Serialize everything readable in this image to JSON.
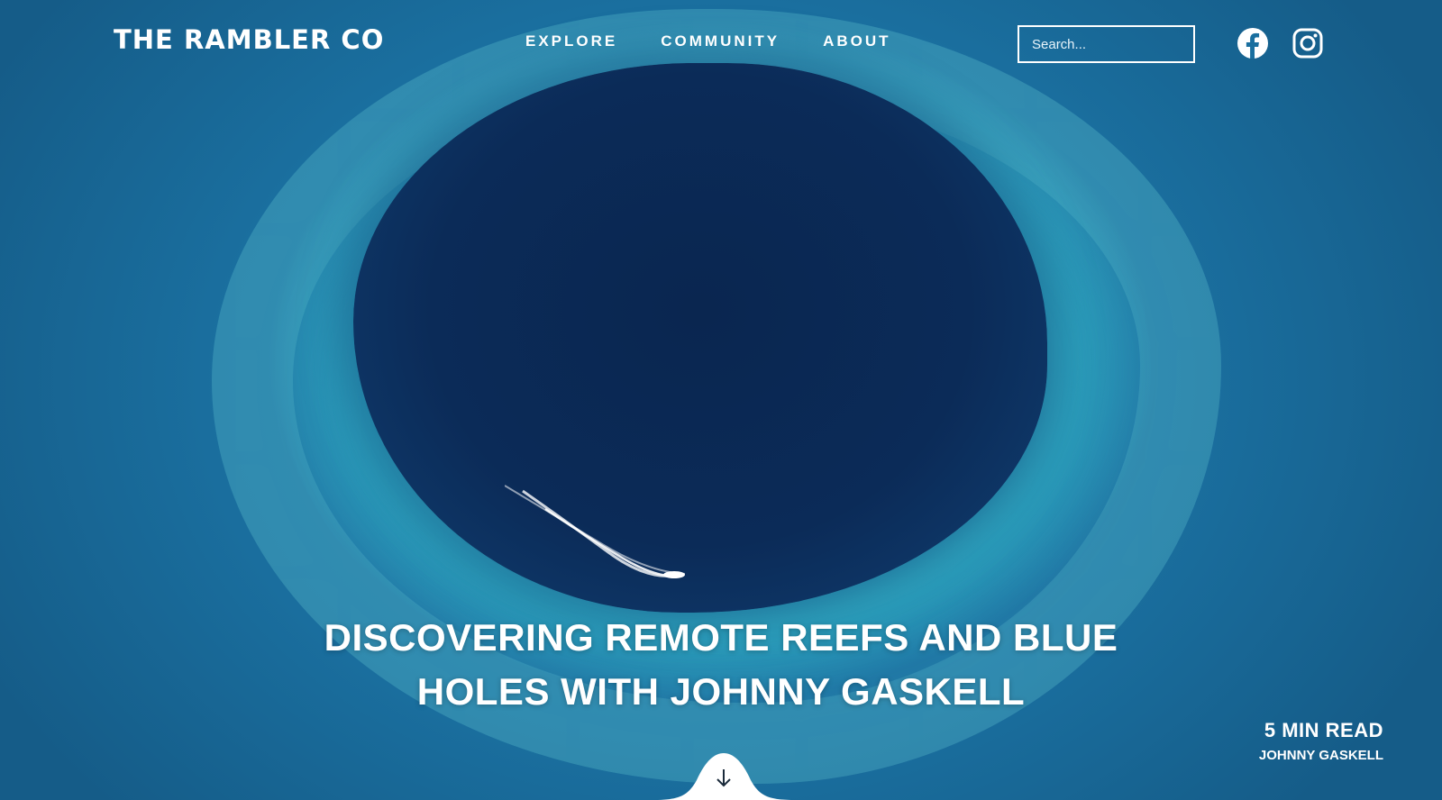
{
  "brand": {
    "logo": "THE RAMBLER CO"
  },
  "nav": {
    "items": [
      "EXPLORE",
      "COMMUNITY",
      "ABOUT"
    ]
  },
  "search": {
    "placeholder": "Search..."
  },
  "social": {
    "icons": [
      "facebook-icon",
      "instagram-icon"
    ]
  },
  "article": {
    "title_line1": "DISCOVERING REMOTE REEFS AND BLUE",
    "title_line2": "HOLES WITH JOHNNY GASKELL",
    "read_time": "5 MIN READ",
    "author": "JOHNNY GASKELL"
  },
  "scroll": {
    "icon": "arrow-down-icon"
  },
  "colors": {
    "text": "#ffffff",
    "deep_blue": "#0b2c55",
    "reef": "#40cdd7",
    "ocean": "#1a6f9f"
  }
}
